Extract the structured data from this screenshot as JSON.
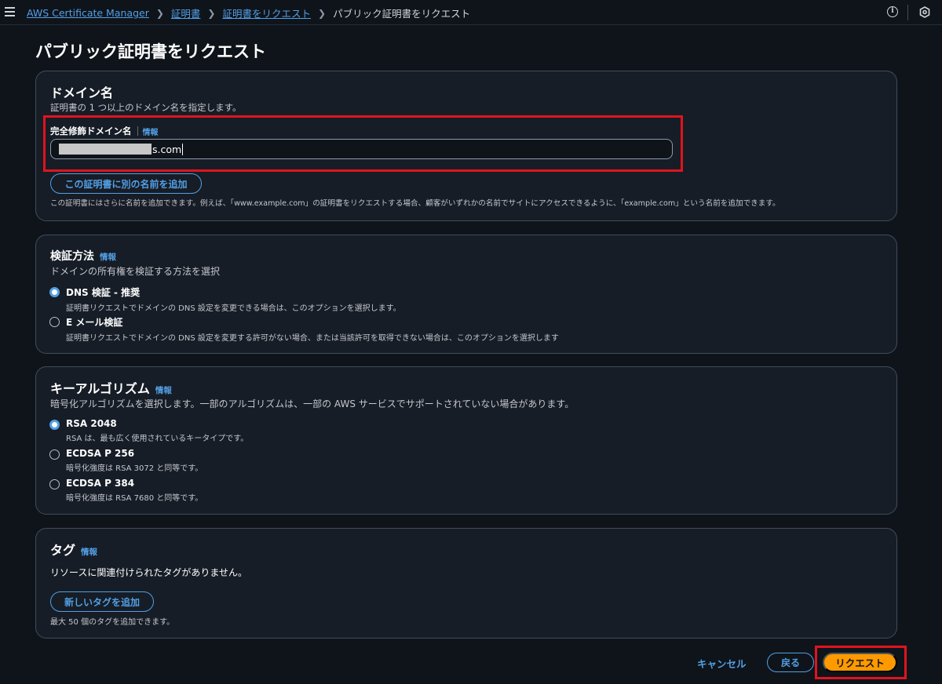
{
  "breadcrumb": {
    "items": [
      "AWS Certificate Manager",
      "証明書",
      "証明書をリクエスト"
    ],
    "current": "パブリック証明書をリクエスト"
  },
  "page": {
    "title": "パブリック証明書をリクエスト"
  },
  "domain": {
    "title": "ドメイン名",
    "description": "証明書の 1 つ以上のドメイン名を指定します。",
    "field_label": "完全修飾ドメイン名",
    "info": "情報",
    "input_value_visible": "s.com",
    "add_name_button": "この証明書に別の名前を追加",
    "add_name_help": "この証明書にはさらに名前を追加できます。例えば、「www.example.com」の証明書をリクエストする場合、顧客がいずれかの名前でサイトにアクセスできるように、「example.com」という名前を追加できます。"
  },
  "validation": {
    "title": "検証方法",
    "info": "情報",
    "description": "ドメインの所有権を検証する方法を選択",
    "options": [
      {
        "label": "DNS 検証 - 推奨",
        "desc": "証明書リクエストでドメインの DNS 設定を変更できる場合は、このオプションを選択します。",
        "selected": true
      },
      {
        "label": "E メール検証",
        "desc": "証明書リクエストでドメインの DNS 設定を変更する許可がない場合、または当該許可を取得できない場合は、このオプションを選択します",
        "selected": false
      }
    ]
  },
  "algorithm": {
    "title": "キーアルゴリズム",
    "info": "情報",
    "description": "暗号化アルゴリズムを選択します。一部のアルゴリズムは、一部の AWS サービスでサポートされていない場合があります。",
    "options": [
      {
        "label": "RSA 2048",
        "desc": "RSA は、最も広く使用されているキータイプです。",
        "selected": true
      },
      {
        "label": "ECDSA P 256",
        "desc": "暗号化強度は RSA 3072 と同等です。",
        "selected": false
      },
      {
        "label": "ECDSA P 384",
        "desc": "暗号化強度は RSA 7680 と同等です。",
        "selected": false
      }
    ]
  },
  "tags": {
    "title": "タグ",
    "info": "情報",
    "empty_text": "リソースに関連付けられたタグがありません。",
    "add_button": "新しいタグを追加",
    "limit_text": "最大 50 個のタグを追加できます。"
  },
  "footer": {
    "cancel": "キャンセル",
    "back": "戻る",
    "submit": "リクエスト"
  },
  "colors": {
    "background": "#0f141a",
    "panel": "#161d26",
    "link": "#539fe5",
    "primary": "#ff9900",
    "highlight": "#e0141e"
  }
}
